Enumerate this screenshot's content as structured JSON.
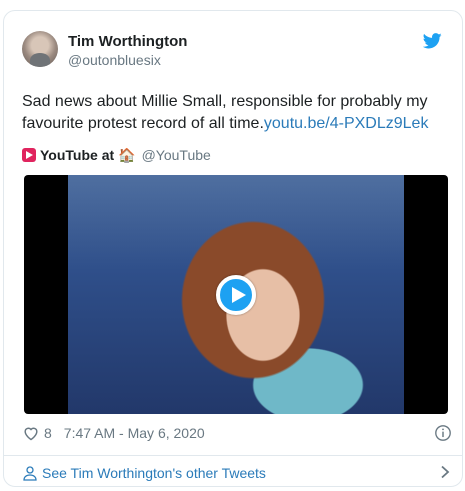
{
  "author": {
    "display_name": "Tim Worthington",
    "handle": "@outonbluesix"
  },
  "tweet": {
    "text": "Sad news about Millie Small, responsible for probably my favourite protest record of all time.",
    "link": "youtu.be/4-PXDLz9Lek"
  },
  "quoted_source": {
    "name": "YouTube at",
    "emoji": "🏠",
    "handle": "@YouTube"
  },
  "meta": {
    "like_count": "8",
    "timestamp": "7:47 AM - May 6, 2020"
  },
  "footer": {
    "label": "See Tim Worthington's other Tweets"
  },
  "colors": {
    "link": "#2b7bb9",
    "twitter_blue": "#1da1f2",
    "muted": "#697882",
    "border": "#e1e8ed"
  }
}
